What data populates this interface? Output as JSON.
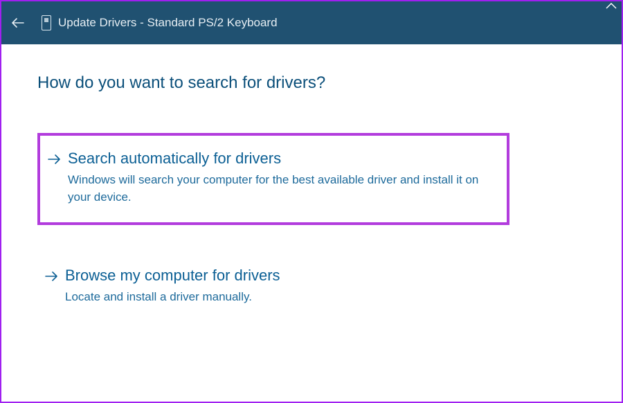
{
  "header": {
    "title": "Update Drivers - Standard PS/2 Keyboard"
  },
  "main": {
    "question": "How do you want to search for drivers?",
    "options": [
      {
        "title": "Search automatically for drivers",
        "description": "Windows will search your computer for the best available driver and install it on your device."
      },
      {
        "title": "Browse my computer for drivers",
        "description": "Locate and install a driver manually."
      }
    ]
  }
}
